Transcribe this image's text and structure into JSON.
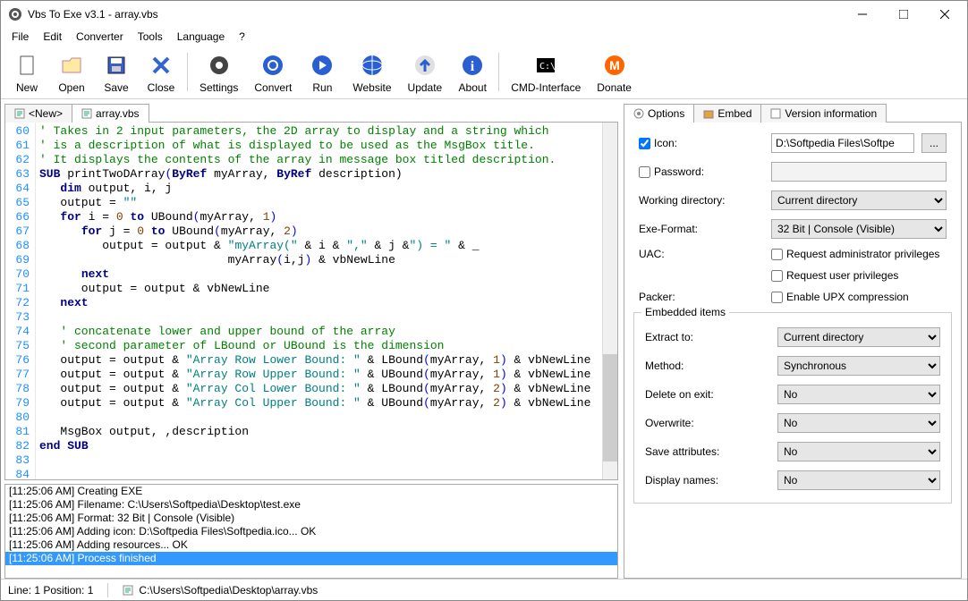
{
  "window": {
    "title": "Vbs To Exe v3.1 - array.vbs"
  },
  "menus": [
    "File",
    "Edit",
    "Converter",
    "Tools",
    "Language",
    "?"
  ],
  "toolbar": [
    {
      "id": "new",
      "label": "New"
    },
    {
      "id": "open",
      "label": "Open"
    },
    {
      "id": "save",
      "label": "Save"
    },
    {
      "id": "close",
      "label": "Close"
    },
    {
      "id": "sep"
    },
    {
      "id": "settings",
      "label": "Settings"
    },
    {
      "id": "convert",
      "label": "Convert"
    },
    {
      "id": "run",
      "label": "Run"
    },
    {
      "id": "website",
      "label": "Website"
    },
    {
      "id": "update",
      "label": "Update"
    },
    {
      "id": "about",
      "label": "About"
    },
    {
      "id": "sep"
    },
    {
      "id": "cmd",
      "label": "CMD-Interface"
    },
    {
      "id": "donate",
      "label": "Donate"
    }
  ],
  "tabs": {
    "new": "<New>",
    "file": "array.vbs"
  },
  "code_lines": [
    {
      "n": 60,
      "parts": [
        {
          "c": "cmt",
          "t": "' Takes in 2 input parameters, the 2D array to display and a string which"
        }
      ]
    },
    {
      "n": 61,
      "parts": [
        {
          "c": "cmt",
          "t": "' is a description of what is displayed to be used as the MsgBox title."
        }
      ]
    },
    {
      "n": 62,
      "parts": [
        {
          "c": "cmt",
          "t": "' It displays the contents of the array in message box titled description."
        }
      ]
    },
    {
      "n": 63,
      "parts": [
        {
          "c": "kw",
          "t": "SUB"
        },
        {
          "t": " printTwoDArray"
        },
        {
          "c": "br",
          "t": "("
        },
        {
          "c": "kw",
          "t": "ByRef"
        },
        {
          "t": " myArray, "
        },
        {
          "c": "kw",
          "t": "ByRef"
        },
        {
          "t": " description)"
        }
      ]
    },
    {
      "n": 64,
      "parts": [
        {
          "t": "   "
        },
        {
          "c": "kw",
          "t": "dim"
        },
        {
          "t": " output, i, j"
        }
      ]
    },
    {
      "n": 65,
      "parts": [
        {
          "t": "   output = "
        },
        {
          "c": "str",
          "t": "\"\""
        }
      ]
    },
    {
      "n": 66,
      "parts": [
        {
          "t": "   "
        },
        {
          "c": "kw",
          "t": "for"
        },
        {
          "t": " i = "
        },
        {
          "c": "num",
          "t": "0"
        },
        {
          "t": " "
        },
        {
          "c": "kw",
          "t": "to"
        },
        {
          "t": " UBound"
        },
        {
          "c": "br",
          "t": "("
        },
        {
          "t": "myArray, "
        },
        {
          "c": "num",
          "t": "1"
        },
        {
          "c": "br",
          "t": ")"
        }
      ]
    },
    {
      "n": 67,
      "parts": [
        {
          "t": "      "
        },
        {
          "c": "kw",
          "t": "for"
        },
        {
          "t": " j = "
        },
        {
          "c": "num",
          "t": "0"
        },
        {
          "t": " "
        },
        {
          "c": "kw",
          "t": "to"
        },
        {
          "t": " UBound"
        },
        {
          "c": "br",
          "t": "("
        },
        {
          "t": "myArray, "
        },
        {
          "c": "num",
          "t": "2"
        },
        {
          "c": "br",
          "t": ")"
        }
      ]
    },
    {
      "n": 68,
      "parts": [
        {
          "t": "         output = output & "
        },
        {
          "c": "str",
          "t": "\"myArray(\""
        },
        {
          "t": " & i & "
        },
        {
          "c": "str",
          "t": "\",\""
        },
        {
          "t": " & j &"
        },
        {
          "c": "str",
          "t": "\") = \""
        },
        {
          "t": " & _"
        }
      ]
    },
    {
      "n": 69,
      "parts": [
        {
          "t": "                           myArray"
        },
        {
          "c": "br",
          "t": "("
        },
        {
          "t": "i,j"
        },
        {
          "c": "br",
          "t": ")"
        },
        {
          "t": " & vbNewLine"
        }
      ]
    },
    {
      "n": 70,
      "parts": [
        {
          "t": "      "
        },
        {
          "c": "kw",
          "t": "next"
        }
      ]
    },
    {
      "n": 71,
      "parts": [
        {
          "t": "      output = output & vbNewLine"
        }
      ]
    },
    {
      "n": 72,
      "parts": [
        {
          "t": "   "
        },
        {
          "c": "kw",
          "t": "next"
        }
      ]
    },
    {
      "n": 73,
      "parts": []
    },
    {
      "n": 74,
      "parts": [
        {
          "t": "   "
        },
        {
          "c": "cmt",
          "t": "' concatenate lower and upper bound of the array"
        }
      ]
    },
    {
      "n": 75,
      "parts": [
        {
          "t": "   "
        },
        {
          "c": "cmt",
          "t": "' second parameter of LBound or UBound is the dimension"
        }
      ]
    },
    {
      "n": 76,
      "parts": [
        {
          "t": "   output = output & "
        },
        {
          "c": "str",
          "t": "\"Array Row Lower Bound: \""
        },
        {
          "t": " & LBound"
        },
        {
          "c": "br",
          "t": "("
        },
        {
          "t": "myArray, "
        },
        {
          "c": "num",
          "t": "1"
        },
        {
          "c": "br",
          "t": ")"
        },
        {
          "t": " & vbNewLine"
        }
      ]
    },
    {
      "n": 77,
      "parts": [
        {
          "t": "   output = output & "
        },
        {
          "c": "str",
          "t": "\"Array Row Upper Bound: \""
        },
        {
          "t": " & UBound"
        },
        {
          "c": "br",
          "t": "("
        },
        {
          "t": "myArray, "
        },
        {
          "c": "num",
          "t": "1"
        },
        {
          "c": "br",
          "t": ")"
        },
        {
          "t": " & vbNewLine"
        }
      ]
    },
    {
      "n": 78,
      "parts": [
        {
          "t": "   output = output & "
        },
        {
          "c": "str",
          "t": "\"Array Col Lower Bound: \""
        },
        {
          "t": " & LBound"
        },
        {
          "c": "br",
          "t": "("
        },
        {
          "t": "myArray, "
        },
        {
          "c": "num",
          "t": "2"
        },
        {
          "c": "br",
          "t": ")"
        },
        {
          "t": " & vbNewLine"
        }
      ]
    },
    {
      "n": 79,
      "parts": [
        {
          "t": "   output = output & "
        },
        {
          "c": "str",
          "t": "\"Array Col Upper Bound: \""
        },
        {
          "t": " & UBound"
        },
        {
          "c": "br",
          "t": "("
        },
        {
          "t": "myArray, "
        },
        {
          "c": "num",
          "t": "2"
        },
        {
          "c": "br",
          "t": ")"
        },
        {
          "t": " & vbNewLine"
        }
      ]
    },
    {
      "n": 80,
      "parts": []
    },
    {
      "n": 81,
      "parts": [
        {
          "t": "   MsgBox output, ,description"
        }
      ]
    },
    {
      "n": 82,
      "parts": [
        {
          "c": "kw",
          "t": "end"
        },
        {
          "t": " "
        },
        {
          "c": "kw",
          "t": "SUB"
        }
      ]
    },
    {
      "n": 83,
      "parts": []
    },
    {
      "n": 84,
      "parts": []
    }
  ],
  "console": [
    {
      "t": "[11:25:06 AM] Creating EXE"
    },
    {
      "t": "[11:25:06 AM] Filename: C:\\Users\\Softpedia\\Desktop\\test.exe"
    },
    {
      "t": "[11:25:06 AM] Format: 32 Bit | Console (Visible)"
    },
    {
      "t": "[11:25:06 AM] Adding icon: D:\\Softpedia Files\\Softpedia.ico... OK"
    },
    {
      "t": "[11:25:06 AM] Adding resources... OK"
    },
    {
      "t": "[11:25:06 AM] Process finished",
      "hl": true
    }
  ],
  "right_tabs": [
    "Options",
    "Embed",
    "Version information"
  ],
  "options": {
    "icon_label": "Icon:",
    "icon_value": "D:\\Softpedia Files\\Softpe",
    "password_label": "Password:",
    "workdir_label": "Working directory:",
    "workdir_value": "Current directory",
    "format_label": "Exe-Format:",
    "format_value": "32 Bit | Console (Visible)",
    "uac_label": "UAC:",
    "uac_admin": "Request administrator privileges",
    "uac_user": "Request user privileges",
    "packer_label": "Packer:",
    "packer_upx": "Enable UPX compression",
    "embed_legend": "Embedded items",
    "extract_label": "Extract to:",
    "extract_value": "Current directory",
    "method_label": "Method:",
    "method_value": "Synchronous",
    "delete_label": "Delete on exit:",
    "delete_value": "No",
    "overwrite_label": "Overwrite:",
    "overwrite_value": "No",
    "saveattr_label": "Save attributes:",
    "saveattr_value": "No",
    "dispnames_label": "Display names:",
    "dispnames_value": "No",
    "browse": "..."
  },
  "status": {
    "pos": "Line: 1 Position: 1",
    "path": "C:\\Users\\Softpedia\\Desktop\\array.vbs"
  }
}
